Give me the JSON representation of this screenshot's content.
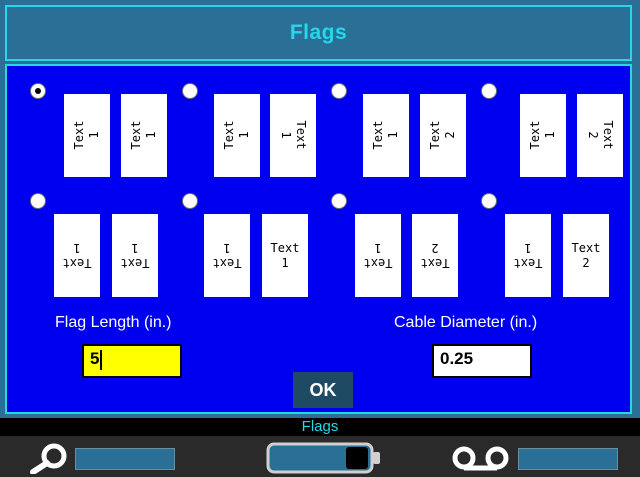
{
  "dialog": {
    "title": "Flags",
    "flag_options": [
      {
        "selected": true,
        "flags": [
          "Text\n1",
          "Text\n1"
        ]
      },
      {
        "selected": false,
        "flags": [
          "Text\n1",
          "Text\n1"
        ]
      },
      {
        "selected": false,
        "flags": [
          "Text\n1",
          "Text\n2"
        ]
      },
      {
        "selected": false,
        "flags": [
          "Text\n1",
          "Text\n2"
        ]
      },
      {
        "selected": false,
        "flags": [
          "Text\n1",
          "Text\n1"
        ]
      },
      {
        "selected": false,
        "flags": [
          "Text\n1",
          "Text\n1"
        ]
      },
      {
        "selected": false,
        "flags": [
          "Text\n1",
          "Text\n2"
        ]
      },
      {
        "selected": false,
        "flags": [
          "Text\n1",
          "Text\n2"
        ]
      }
    ],
    "flag_length": {
      "label": "Flag Length (in.)",
      "value": "5"
    },
    "cable_diameter": {
      "label": "Cable Diameter (in.)",
      "value": "0.25"
    },
    "ok_label": "OK"
  },
  "status": {
    "mode_label": "Flags",
    "icons": [
      "magnifier-icon",
      "battery-icon",
      "tape-cassette-icon"
    ],
    "colors": {
      "accent": "#27d6e8",
      "panel": "#0000f0",
      "frame": "#2a6f96",
      "input_active": "#ffff00"
    }
  }
}
